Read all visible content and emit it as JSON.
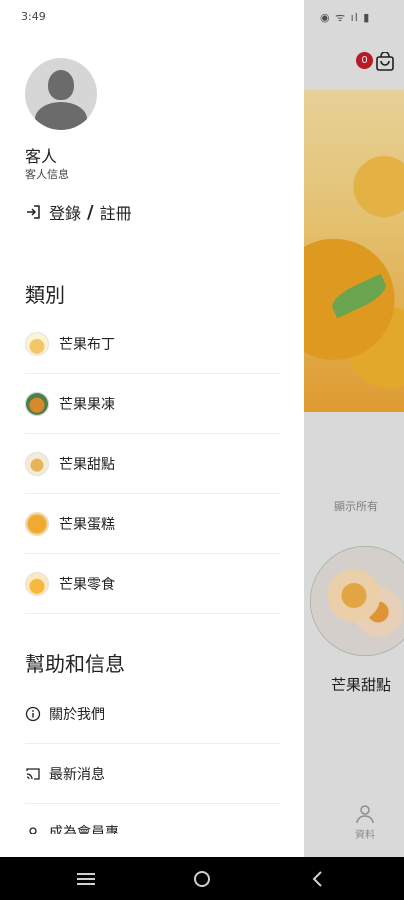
{
  "status_bar": {
    "time": "3:49"
  },
  "drawer": {
    "user": {
      "name": "客人",
      "info": "客人信息"
    },
    "login": {
      "login_label": "登錄",
      "separator": "/",
      "register_label": "註冊"
    },
    "categories_title": "類別",
    "categories": [
      {
        "label": "芒果布丁",
        "thumb_color": "#f4c66a"
      },
      {
        "label": "芒果果凍",
        "thumb_color": "#d9892b"
      },
      {
        "label": "芒果甜點",
        "thumb_color": "#e6b55a"
      },
      {
        "label": "芒果蛋糕",
        "thumb_color": "#f1a936"
      },
      {
        "label": "芒果零食",
        "thumb_color": "#f6b93b"
      }
    ],
    "help_title": "幫助和信息",
    "help_items": [
      {
        "label": "關於我們",
        "icon": "info-icon"
      },
      {
        "label": "最新消息",
        "icon": "cast-icon"
      },
      {
        "label": "成為會員專",
        "icon": "user-icon"
      }
    ]
  },
  "background": {
    "cart_count": "0",
    "show_all": "顯示所有",
    "product_name": "芒果甜點",
    "tab_label": "資料"
  },
  "colors": {
    "badge": "#c81d2a",
    "accent": "#f1a936"
  }
}
